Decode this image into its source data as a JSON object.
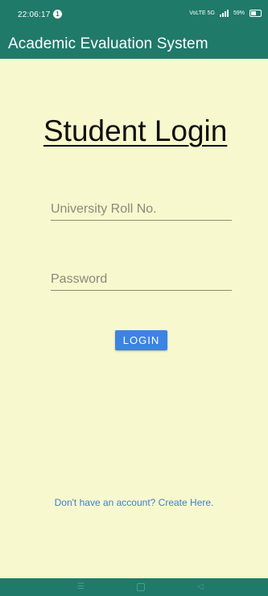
{
  "status_bar": {
    "time": "22:06:17",
    "notification_badge": "1",
    "network_text": "VoLTE 5G",
    "battery_text": "59%"
  },
  "app_bar": {
    "title": "Academic Evaluation System"
  },
  "login": {
    "heading": "Student Login",
    "roll_placeholder": "University Roll No.",
    "roll_value": "",
    "password_placeholder": "Password",
    "password_value": "",
    "button_label": "LOGIN",
    "signup_link": "Don't have an account? Create Here."
  },
  "nav_bar": {
    "icons": [
      "menu-icon",
      "home-icon",
      "back-icon"
    ]
  },
  "colors": {
    "primary": "#1f7a6a",
    "background": "#f8f8ce",
    "button": "#3d83e3",
    "link": "#3e7fcf"
  }
}
